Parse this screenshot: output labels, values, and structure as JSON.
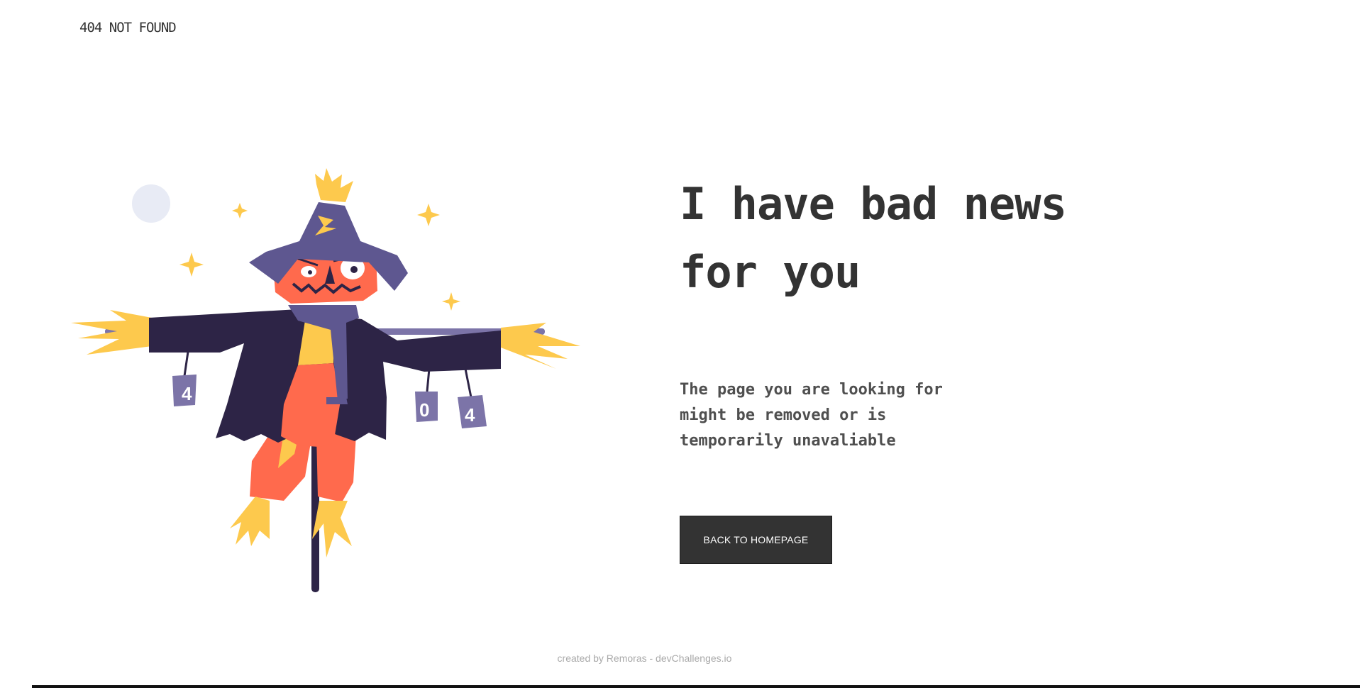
{
  "header": {
    "brand": "404 NOT FOUND"
  },
  "main": {
    "headline": "I have bad news for you",
    "message": "The page you are looking for might be removed or is temporarily unavaliable",
    "button_label": "BACK TO HOMEPAGE"
  },
  "illustration": {
    "subject": "scarecrow",
    "can_labels": [
      "4",
      "0",
      "4"
    ]
  },
  "footer": {
    "credit": "created by Remoras - devChallenges.io"
  },
  "colors": {
    "text": "#333333",
    "button_bg": "#333333",
    "button_text": "#ffffff",
    "hat": "#5e5790",
    "coat": "#2d2446",
    "pumpkin": "#ff6a4d",
    "straw": "#fdc94d",
    "moon": "#e8ebf5",
    "can": "#7c74a8"
  }
}
